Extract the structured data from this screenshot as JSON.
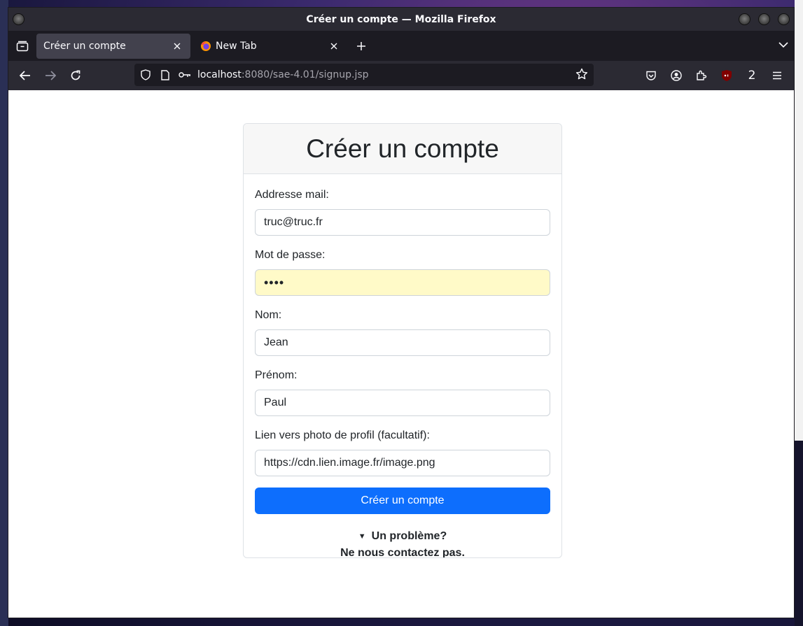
{
  "window": {
    "title": "Créer un compte — Mozilla Firefox"
  },
  "tabs": [
    {
      "label": "Créer un compte",
      "active": true
    },
    {
      "label": "New Tab",
      "active": false
    }
  ],
  "urlbar": {
    "host": "localhost",
    "path": ":8080/sae-4.01/signup.jsp"
  },
  "toolbar": {
    "extension_count": "2"
  },
  "form": {
    "heading": "Créer un compte",
    "email": {
      "label": "Addresse mail:",
      "value": "truc@truc.fr"
    },
    "password": {
      "label": "Mot de passe:",
      "value": "••••"
    },
    "nom": {
      "label": "Nom:",
      "value": "Jean"
    },
    "prenom": {
      "label": "Prénom:",
      "value": "Paul"
    },
    "photo": {
      "label": "Lien vers photo de profil (facultatif):",
      "value": "https://cdn.lien.image.fr/image.png"
    },
    "submit_label": "Créer un compte"
  },
  "help": {
    "summary": "Un problème?",
    "message": "Ne nous contactez pas."
  },
  "colors": {
    "primary_button": "#0d6efd",
    "autofill_bg": "#fffac8",
    "chrome_dark": "#2b2a33"
  }
}
